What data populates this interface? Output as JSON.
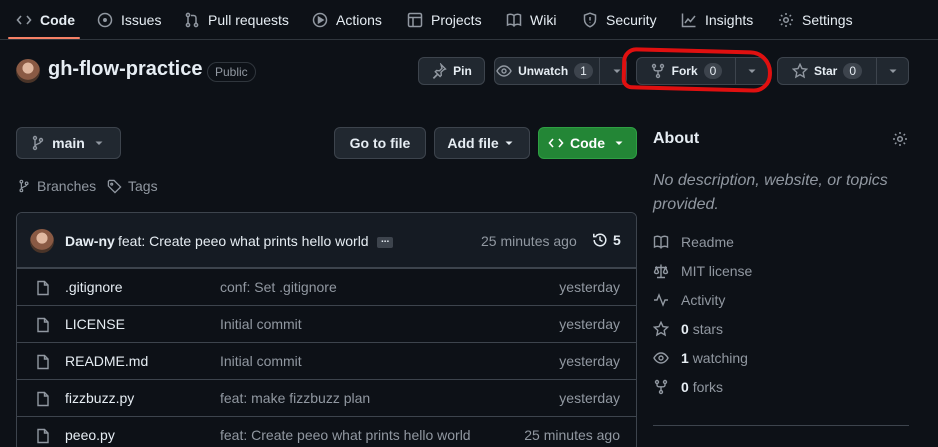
{
  "nav": {
    "items": [
      {
        "icon": "code-icon",
        "label": "Code",
        "active": true
      },
      {
        "icon": "issue-icon",
        "label": "Issues"
      },
      {
        "icon": "pull-request-icon",
        "label": "Pull requests"
      },
      {
        "icon": "play-icon",
        "label": "Actions"
      },
      {
        "icon": "table-icon",
        "label": "Projects"
      },
      {
        "icon": "book-icon",
        "label": "Wiki"
      },
      {
        "icon": "shield-icon",
        "label": "Security"
      },
      {
        "icon": "graph-icon",
        "label": "Insights"
      },
      {
        "icon": "gear-icon",
        "label": "Settings"
      }
    ],
    "accent": "#f78166"
  },
  "repo": {
    "name": "gh-flow-practice",
    "visibility": "Public"
  },
  "actions": {
    "pin_label": "Pin",
    "unwatch_label": "Unwatch",
    "watch_count": "1",
    "fork_label": "Fork",
    "fork_count": "0",
    "star_label": "Star",
    "star_count": "0"
  },
  "annotation_color": "#e01010",
  "branch": {
    "current": "main",
    "branches_label": "Branches",
    "tags_label": "Tags"
  },
  "toolbar": {
    "go_to_file": "Go to file",
    "add_file": "Add file",
    "code": "Code",
    "code_color": "#238636"
  },
  "latest_commit": {
    "author": "Daw-ny",
    "message": "feat: Create peeo what prints hello world",
    "ellipsis": "...",
    "time": "25 minutes ago",
    "commit_count": "5"
  },
  "files": [
    {
      "name": ".gitignore",
      "message": "conf: Set .gitignore",
      "time": "yesterday"
    },
    {
      "name": "LICENSE",
      "message": "Initial commit",
      "time": "yesterday"
    },
    {
      "name": "README.md",
      "message": "Initial commit",
      "time": "yesterday"
    },
    {
      "name": "fizzbuzz.py",
      "message": "feat: make fizzbuzz plan",
      "time": "yesterday"
    },
    {
      "name": "peeo.py",
      "message": "feat: Create peeo what prints hello world",
      "time": "25 minutes ago"
    }
  ],
  "about": {
    "title": "About",
    "description": "No description, website, or topics provided.",
    "readme": "Readme",
    "license": "MIT license",
    "activity": "Activity",
    "stars_count": "0",
    "stars_label": "stars",
    "watching_count": "1",
    "watching_label": "watching",
    "forks_count": "0",
    "forks_label": "forks"
  }
}
